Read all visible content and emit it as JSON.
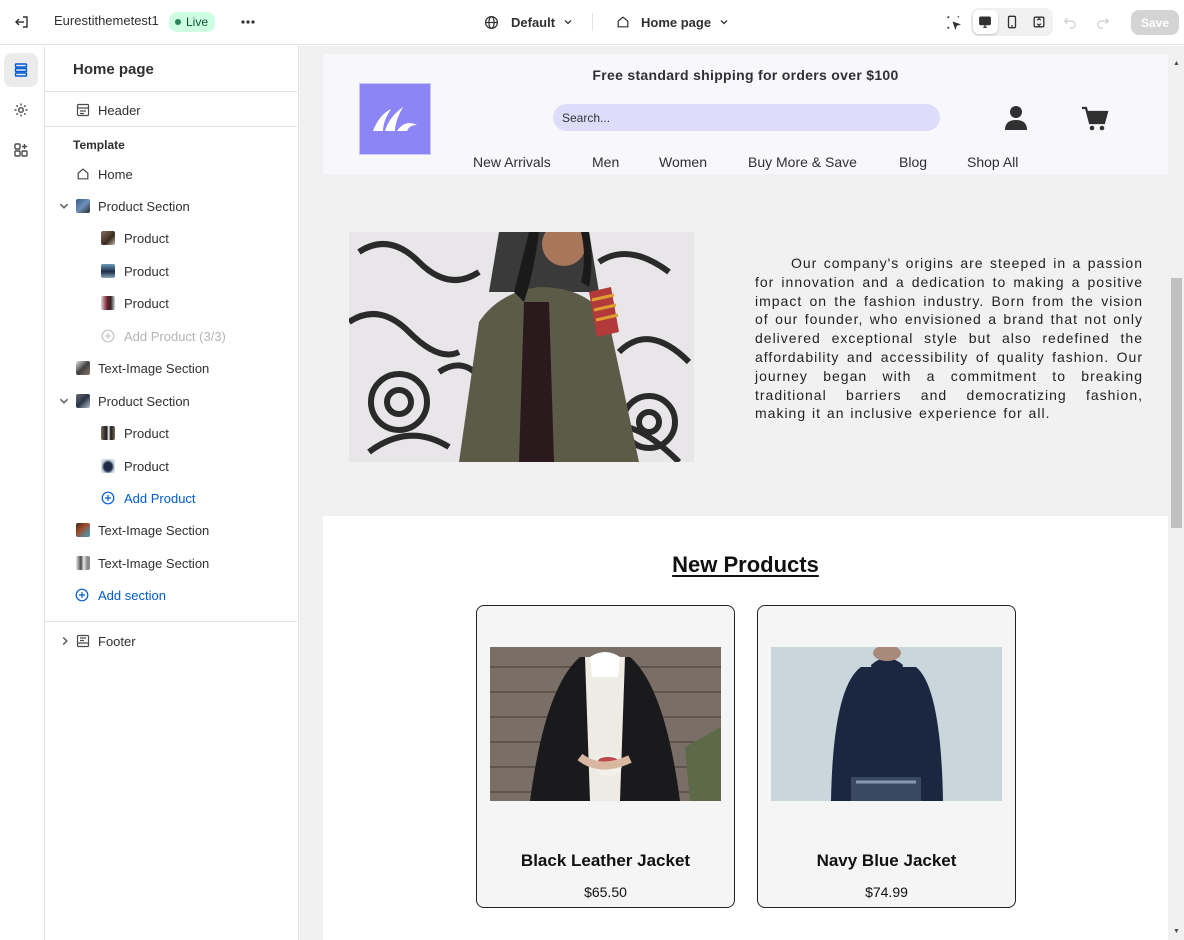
{
  "topbar": {
    "store_name": "Eurestithemetest1",
    "status_badge": "Live",
    "theme_selector": "Default",
    "page_selector": "Home page",
    "save_label": "Save"
  },
  "sidebar": {
    "title": "Home page",
    "header_item": "Header",
    "template_heading": "Template",
    "home_item": "Home",
    "product_section_1": "Product Section",
    "product_1": "Product",
    "product_2": "Product",
    "product_3": "Product",
    "add_product_disabled": "Add Product (3/3)",
    "text_image_1": "Text-Image Section",
    "product_section_2": "Product Section",
    "product_4": "Product",
    "product_5": "Product",
    "add_product": "Add Product",
    "text_image_2": "Text-Image Section",
    "text_image_3": "Text-Image Section",
    "add_section": "Add section",
    "footer_item": "Footer"
  },
  "site": {
    "announcement": "Free standard shipping for orders over $100",
    "search_placeholder": "Search...",
    "nav": [
      "New Arrivals",
      "Men",
      "Women",
      "Buy More & Save",
      "Blog",
      "Shop All"
    ],
    "about_text": "Our company's origins are steeped in a passion for innovation and a dedication to making a positive impact on the fashion industry. Born from the vision of our founder, who envisioned a brand that not only delivered exceptional style but also redefined the affordability and accessibility of quality fashion. Our journey began with a commitment to breaking traditional barriers and democratizing fashion, making it an inclusive experience for all.",
    "new_products_title": "New Products",
    "products": [
      {
        "name": "Black Leather Jacket",
        "price": "$65.50"
      },
      {
        "name": "Navy Blue Jacket",
        "price": "$74.99"
      }
    ]
  },
  "colors": {
    "live_badge_bg": "#cdfee1",
    "link_blue": "#005bd3",
    "logo_purple": "#8b85f5",
    "search_bg": "#dedcfb"
  },
  "icons": [
    "exit-icon",
    "more-icon",
    "globe-icon",
    "home-icon",
    "inspect-icon",
    "desktop-icon",
    "mobile-icon",
    "fullscreen-icon",
    "undo-icon",
    "redo-icon",
    "sections-icon",
    "settings-icon",
    "apps-icon",
    "account-icon",
    "cart-icon"
  ]
}
